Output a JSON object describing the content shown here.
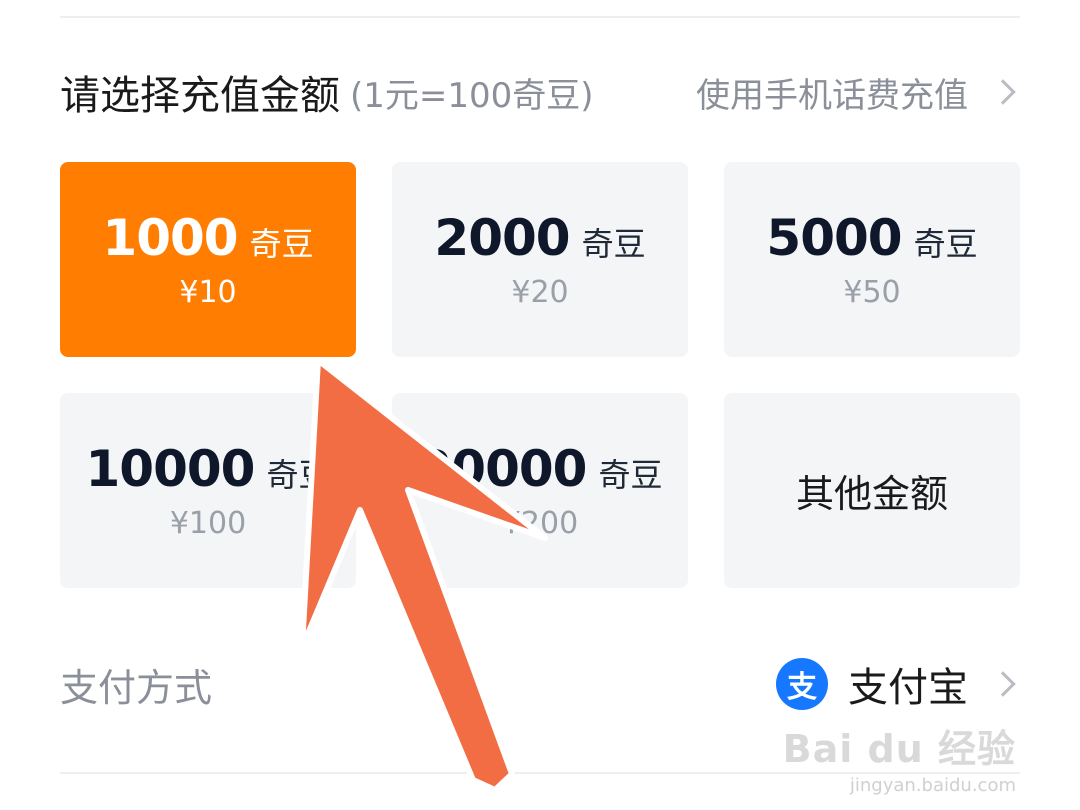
{
  "header": {
    "title": "请选择充值金额",
    "subtitle": "(1元=100奇豆)",
    "link_label": "使用手机话费充值"
  },
  "options": [
    {
      "amount": "1000",
      "unit": "奇豆",
      "price": "¥10",
      "selected": true
    },
    {
      "amount": "2000",
      "unit": "奇豆",
      "price": "¥20",
      "selected": false
    },
    {
      "amount": "5000",
      "unit": "奇豆",
      "price": "¥50",
      "selected": false
    },
    {
      "amount": "10000",
      "unit": "奇豆",
      "price": "¥100",
      "selected": false
    },
    {
      "amount": "20000",
      "unit": "奇豆",
      "price": "¥200",
      "selected": false
    }
  ],
  "other_amount_label": "其他金额",
  "payment": {
    "label": "支付方式",
    "icon_glyph": "支",
    "method": "支付宝"
  },
  "watermark": {
    "logo": "Bai du 经验",
    "url": "jingyan.baidu.com"
  },
  "colors": {
    "accent": "#ff7d00",
    "card_bg": "#f4f5f7",
    "alipay_blue": "#1677ff",
    "annotation_arrow": "#f26d43"
  }
}
